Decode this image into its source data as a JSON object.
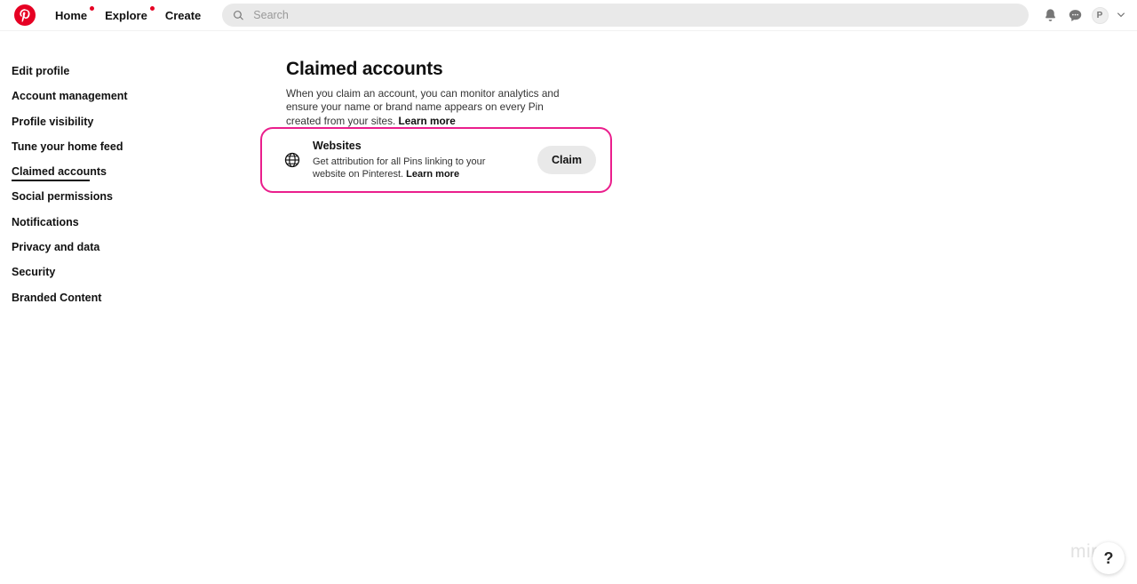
{
  "header": {
    "logo_name": "pinterest-logo",
    "nav": [
      {
        "label": "Home",
        "badge": true
      },
      {
        "label": "Explore",
        "badge": true
      },
      {
        "label": "Create",
        "badge": false
      }
    ],
    "search": {
      "placeholder": "Search",
      "value": "",
      "icon": "search-icon"
    },
    "actions": [
      {
        "name": "notifications-icon",
        "glyph": "bell"
      },
      {
        "name": "messages-icon",
        "glyph": "chat-bubble"
      }
    ],
    "avatar_initial": "P",
    "chevron": "chevron-down-icon"
  },
  "sidebar": {
    "items": [
      {
        "label": "Edit profile",
        "active": false
      },
      {
        "label": "Account management",
        "active": false
      },
      {
        "label": "Profile visibility",
        "active": false
      },
      {
        "label": "Tune your home feed",
        "active": false
      },
      {
        "label": "Claimed accounts",
        "active": true
      },
      {
        "label": "Social permissions",
        "active": false
      },
      {
        "label": "Notifications",
        "active": false
      },
      {
        "label": "Privacy and data",
        "active": false
      },
      {
        "label": "Security",
        "active": false
      },
      {
        "label": "Branded Content",
        "active": false
      }
    ]
  },
  "main": {
    "title": "Claimed accounts",
    "description": "When you claim an account, you can monitor analytics and ensure your name or brand name appears on every Pin created from your sites. ",
    "description_link": "Learn more"
  },
  "card": {
    "icon": "globe-icon",
    "title": "Websites",
    "description": "Get attribution for all Pins linking to your website on Pinterest. ",
    "description_link": "Learn more",
    "button_label": "Claim",
    "highlight_color": "#ea1e8c"
  },
  "overlay": {
    "watermark": "miro",
    "help_label": "?"
  },
  "colors": {
    "brand_red": "#e60023",
    "text_primary": "#111111",
    "text_secondary": "#333333",
    "field_bg": "#e9e9e9",
    "highlight_pink": "#ea1e8c"
  }
}
